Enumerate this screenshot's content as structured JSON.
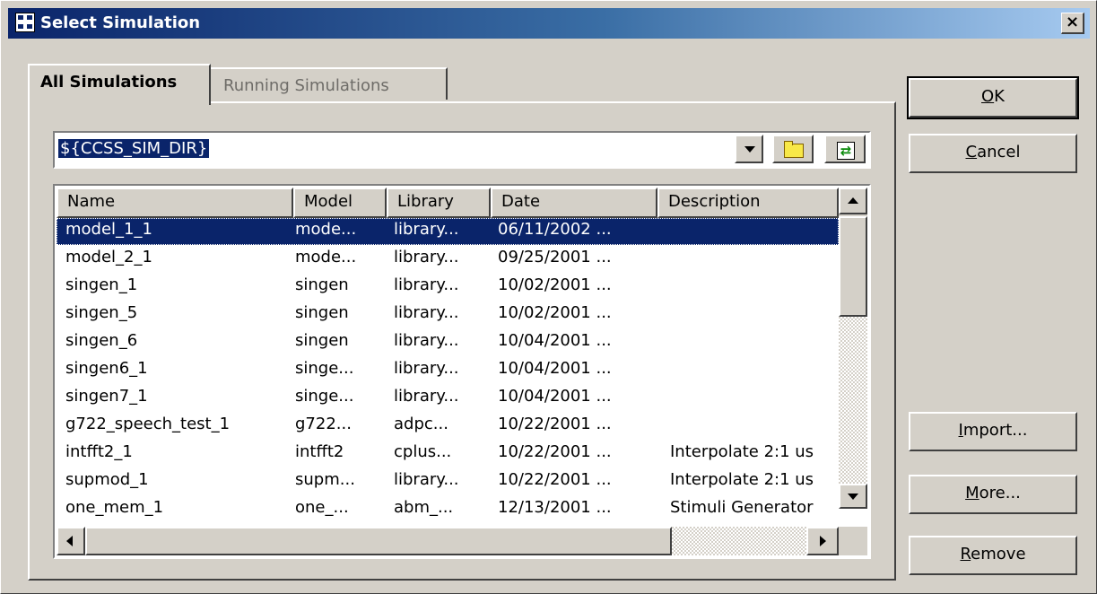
{
  "window": {
    "title": "Select Simulation",
    "close_label": "×"
  },
  "tabs": [
    {
      "label": "All Simulations",
      "active": true
    },
    {
      "label": "Running Simulations",
      "active": false
    }
  ],
  "path_combo": {
    "value": "${CCSS_SIM_DIR}"
  },
  "icons": {
    "dropdown": "chevron-down-icon",
    "browse": "folder-icon",
    "refresh": "refresh-icon"
  },
  "table": {
    "columns": [
      "Name",
      "Model",
      "Library",
      "Date",
      "Description"
    ],
    "rows": [
      {
        "name": "model_1_1",
        "model": "mode...",
        "library": "library...",
        "date": "06/11/2002 ...",
        "description": "",
        "selected": true
      },
      {
        "name": "model_2_1",
        "model": "mode...",
        "library": "library...",
        "date": "09/25/2001 ...",
        "description": ""
      },
      {
        "name": "singen_1",
        "model": "singen",
        "library": "library...",
        "date": "10/02/2001 ...",
        "description": ""
      },
      {
        "name": "singen_5",
        "model": "singen",
        "library": "library...",
        "date": "10/02/2001 ...",
        "description": ""
      },
      {
        "name": "singen_6",
        "model": "singen",
        "library": "library...",
        "date": "10/04/2001 ...",
        "description": ""
      },
      {
        "name": "singen6_1",
        "model": "singe...",
        "library": "library...",
        "date": "10/04/2001 ...",
        "description": ""
      },
      {
        "name": "singen7_1",
        "model": "singe...",
        "library": "library...",
        "date": "10/04/2001 ...",
        "description": ""
      },
      {
        "name": "g722_speech_test_1",
        "model": "g722...",
        "library": "adpc...",
        "date": "10/22/2001 ...",
        "description": ""
      },
      {
        "name": "intfft2_1",
        "model": "intfft2",
        "library": "cplus...",
        "date": "10/22/2001 ...",
        "description": "Interpolate 2:1 us"
      },
      {
        "name": "supmod_1",
        "model": "supm...",
        "library": "library...",
        "date": "10/22/2001 ...",
        "description": "Interpolate 2:1 us"
      },
      {
        "name": "one_mem_1",
        "model": "one_...",
        "library": "abm_...",
        "date": "12/13/2001 ...",
        "description": "Stimuli Generator"
      }
    ]
  },
  "buttons": {
    "ok": {
      "mnemonic": "O",
      "rest": "K"
    },
    "cancel": {
      "mnemonic": "C",
      "rest": "ancel"
    },
    "import": {
      "mnemonic": "I",
      "rest": "mport..."
    },
    "more": {
      "mnemonic": "M",
      "rest": "ore..."
    },
    "remove": {
      "mnemonic": "R",
      "rest": "emove"
    }
  }
}
